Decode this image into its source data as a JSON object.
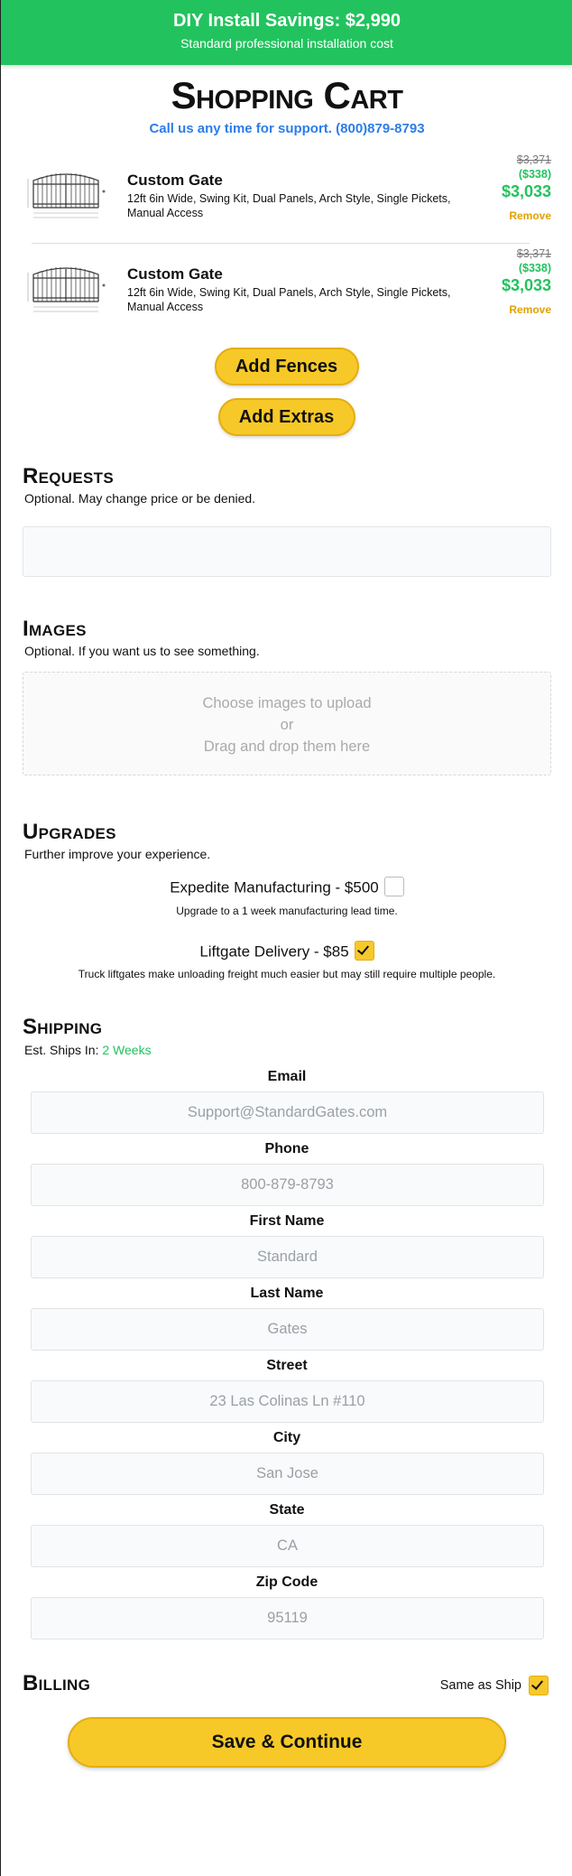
{
  "banner": {
    "title": "DIY Install Savings: $2,990",
    "subtitle": "Standard professional installation cost"
  },
  "header": {
    "title": "Shopping Cart",
    "support": "Call us any time for support. (800)879-8793"
  },
  "cart_items": [
    {
      "name": "Custom Gate",
      "description": "12ft 6in Wide, Swing Kit, Dual Panels, Arch Style, Single Pickets, Manual Access",
      "original_price": "$3,371",
      "discount": "($338)",
      "price": "$3,033",
      "remove_label": "Remove"
    },
    {
      "name": "Custom Gate",
      "description": "12ft 6in Wide, Swing Kit, Dual Panels, Arch Style, Single Pickets, Manual Access",
      "original_price": "$3,371",
      "discount": "($338)",
      "price": "$3,033",
      "remove_label": "Remove"
    }
  ],
  "actions": {
    "add_fences": "Add Fences",
    "add_extras": "Add Extras"
  },
  "requests": {
    "title": "Requests",
    "subtitle": "Optional. May change price or be denied.",
    "value": ""
  },
  "images": {
    "title": "Images",
    "subtitle": "Optional. If you want us to see something.",
    "line1": "Choose images to upload",
    "line2": "or",
    "line3": "Drag and drop them here"
  },
  "upgrades": {
    "title": "Upgrades",
    "subtitle": "Further improve your experience.",
    "items": [
      {
        "label": "Expedite Manufacturing - $500",
        "note": "Upgrade to a 1 week manufacturing lead time.",
        "checked": false
      },
      {
        "label": "Liftgate Delivery - $85",
        "note": "Truck liftgates make unloading freight much easier but may still require multiple people.",
        "checked": true
      }
    ]
  },
  "shipping": {
    "title": "Shipping",
    "est_label": "Est. Ships In:",
    "est_value": "2 Weeks",
    "fields": [
      {
        "label": "Email",
        "placeholder": "Support@StandardGates.com"
      },
      {
        "label": "Phone",
        "placeholder": "800-879-8793"
      },
      {
        "label": "First Name",
        "placeholder": "Standard"
      },
      {
        "label": "Last Name",
        "placeholder": "Gates"
      },
      {
        "label": "Street",
        "placeholder": "23 Las Colinas Ln #110"
      },
      {
        "label": "City",
        "placeholder": "San Jose"
      },
      {
        "label": "State",
        "placeholder": "CA"
      },
      {
        "label": "Zip Code",
        "placeholder": "95119"
      }
    ]
  },
  "billing": {
    "title": "Billing",
    "same_as_ship_label": "Same as Ship",
    "same_as_ship": true
  },
  "footer": {
    "save_label": "Save & Continue"
  },
  "colors": {
    "banner": "#22c35e",
    "accent": "#f7c928",
    "link": "#2b7de9",
    "remove": "#e0a100"
  }
}
